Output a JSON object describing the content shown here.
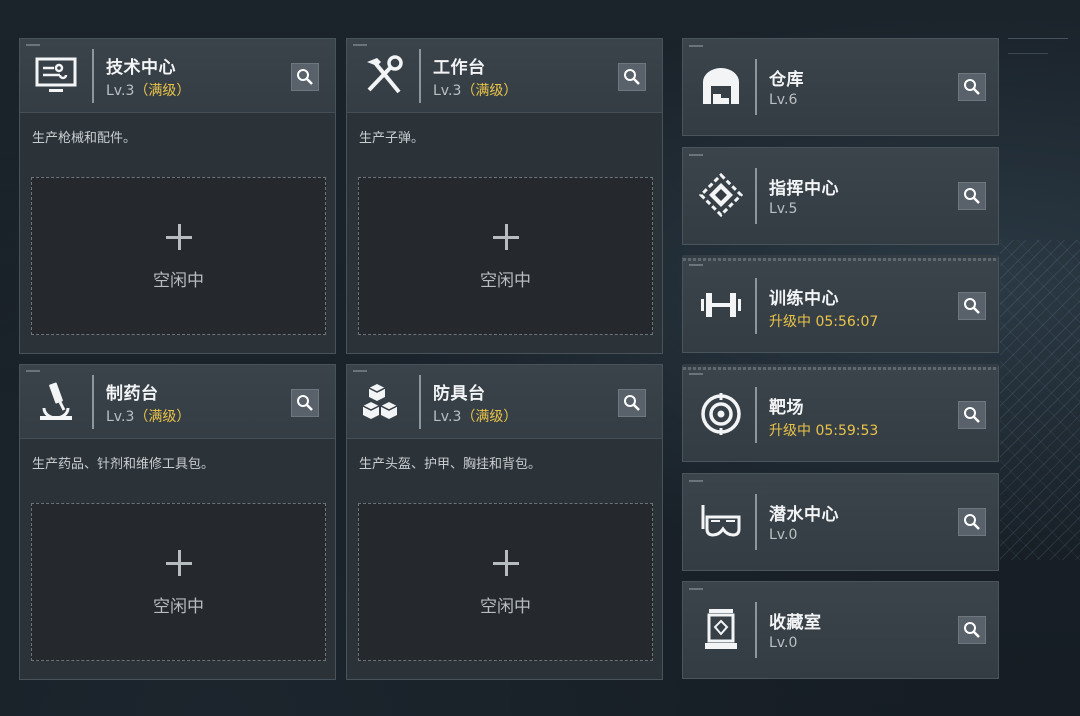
{
  "workshops": [
    {
      "id": "tech-center",
      "title": "技术中心",
      "level": "Lv.3",
      "badge": "（满级）",
      "icon": "computer-icon",
      "description": "生产枪械和配件。",
      "slot_label": "空闲中"
    },
    {
      "id": "workbench",
      "title": "工作台",
      "level": "Lv.3",
      "badge": "（满级）",
      "icon": "hammer-wrench-icon",
      "description": "生产子弹。",
      "slot_label": "空闲中"
    },
    {
      "id": "pharmacy",
      "title": "制药台",
      "level": "Lv.3",
      "badge": "（满级）",
      "icon": "microscope-icon",
      "description": "生产药品、针剂和维修工具包。",
      "slot_label": "空闲中"
    },
    {
      "id": "armor-bench",
      "title": "防具台",
      "level": "Lv.3",
      "badge": "（满级）",
      "icon": "boxes-icon",
      "description": "生产头盔、护甲、胸挂和背包。",
      "slot_label": "空闲中"
    }
  ],
  "facilities": [
    {
      "id": "warehouse",
      "title": "仓库",
      "status": "Lv.6",
      "upgrading": false,
      "icon": "warehouse-icon"
    },
    {
      "id": "command-center",
      "title": "指挥中心",
      "status": "Lv.5",
      "upgrading": false,
      "icon": "diamond-emblem-icon"
    },
    {
      "id": "training-center",
      "title": "训练中心",
      "status": "升级中 05:56:07",
      "upgrading": true,
      "icon": "dumbbell-icon"
    },
    {
      "id": "shooting-range",
      "title": "靶场",
      "status": "升级中 05:59:53",
      "upgrading": true,
      "icon": "target-icon"
    },
    {
      "id": "diving-center",
      "title": "潜水中心",
      "status": "Lv.0",
      "upgrading": false,
      "icon": "diving-mask-icon"
    },
    {
      "id": "collection-room",
      "title": "收藏室",
      "status": "Lv.0",
      "upgrading": false,
      "icon": "display-case-icon"
    }
  ],
  "colors": {
    "accent_gold": "#e8c34a",
    "panel_bg": "#2b3238",
    "header_bg": "#3a434a"
  }
}
